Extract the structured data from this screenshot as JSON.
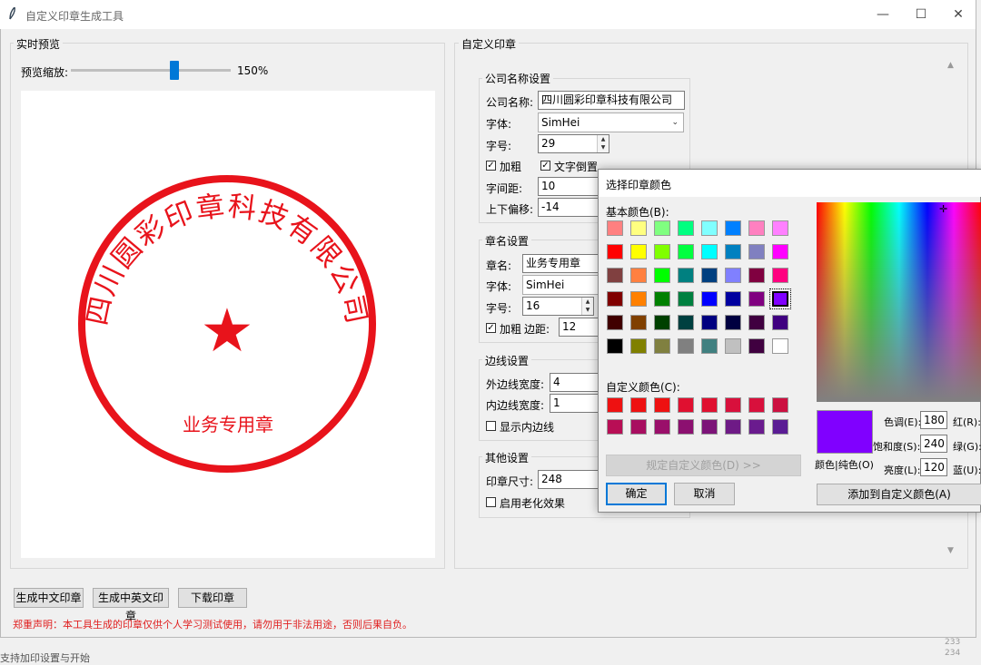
{
  "window": {
    "title": "自定义印章生成工具"
  },
  "preview": {
    "group_title": "实时预览",
    "zoom_label": "预览缩放:",
    "zoom_value": "150%",
    "zoom_fraction": 0.6
  },
  "seal": {
    "company": "四川圆彩印章科技有限公司",
    "name": "业务专用章",
    "star": "★",
    "color": "#e8131b"
  },
  "settings": {
    "group_title": "自定义印章",
    "company_group": {
      "title": "公司名称设置",
      "name_label": "公司名称:",
      "name_value": "四川圆彩印章科技有限公司",
      "font_label": "字体:",
      "font_value": "SimHei",
      "size_label": "字号:",
      "size_value": "29",
      "bold_label": "加粗",
      "invert_label": "文字倒置",
      "spacing_label": "字间距:",
      "spacing_value": "10",
      "offset_label": "上下偏移:",
      "offset_value": "-14"
    },
    "seal_group": {
      "title": "章名设置",
      "name_label": "章名:",
      "name_value": "业务专用章",
      "font_label": "字体:",
      "font_value": "SimHei",
      "size_label": "字号:",
      "size_value": "16",
      "bold_label": "加粗",
      "spacing_label": "边距:",
      "spacing_value": "12"
    },
    "border_group": {
      "title": "边线设置",
      "outer_label": "外边线宽度:",
      "outer_value": "4",
      "inner_label": "内边线宽度:",
      "inner_value": "1",
      "show_inner_label": "显示内边线"
    },
    "other_group": {
      "title": "其他设置",
      "size_label": "印章尺寸:",
      "size_value": "248",
      "aging_label": "启用老化效果"
    }
  },
  "buttons": {
    "gen_cn": "生成中文印章",
    "gen_cn_en": "生成中英文印章",
    "download": "下载印章"
  },
  "disclaimer": "郑重声明：本工具生成的印章仅供个人学习测试使用，请勿用于非法用途，否则后果自负。",
  "color_dialog": {
    "title": "选择印章颜色",
    "basic_label": "基本颜色(B):",
    "custom_label": "自定义颜色(C):",
    "define_button": "规定自定义颜色(D) >>",
    "ok": "确定",
    "cancel": "取消",
    "solid_label": "颜色|纯色(O)",
    "hue_label": "色调(E):",
    "hue_value": "180",
    "sat_label": "饱和度(S):",
    "sat_value": "240",
    "lum_label": "亮度(L):",
    "lum_value": "120",
    "red_label": "红(R):",
    "green_label": "绿(G):",
    "blue_label": "蓝(U):",
    "add_button": "添加到自定义颜色(A)",
    "selected_color": "#8000ff",
    "basic_colors": [
      "#ff8080",
      "#ffff80",
      "#80ff80",
      "#00ff80",
      "#80ffff",
      "#0080ff",
      "#ff80c0",
      "#ff80ff",
      "#ff0000",
      "#ffff00",
      "#80ff00",
      "#00ff40",
      "#00ffff",
      "#0080c0",
      "#8080c0",
      "#ff00ff",
      "#804040",
      "#ff8040",
      "#00ff00",
      "#008080",
      "#004080",
      "#8080ff",
      "#800040",
      "#ff0080",
      "#800000",
      "#ff8000",
      "#008000",
      "#008040",
      "#0000ff",
      "#0000a0",
      "#800080",
      "#8000ff",
      "#400000",
      "#804000",
      "#004000",
      "#004040",
      "#000080",
      "#000040",
      "#400040",
      "#400080",
      "#000000",
      "#808000",
      "#808040",
      "#808080",
      "#408080",
      "#c0c0c0",
      "#400040",
      "#ffffff"
    ],
    "custom_colors": [
      "#ee1111",
      "#ee1111",
      "#ee1111",
      "#e01030",
      "#e01030",
      "#d8103c",
      "#d8103c",
      "#cc1040",
      "#b80e55",
      "#a80e60",
      "#9a0f6a",
      "#8c1070",
      "#7c1378",
      "#6e1a86",
      "#6a1b8e",
      "#5a1c94"
    ]
  },
  "edge_text": {
    "n1": "233",
    "n2": "234",
    "bottom": "支持加印设置与开始"
  }
}
